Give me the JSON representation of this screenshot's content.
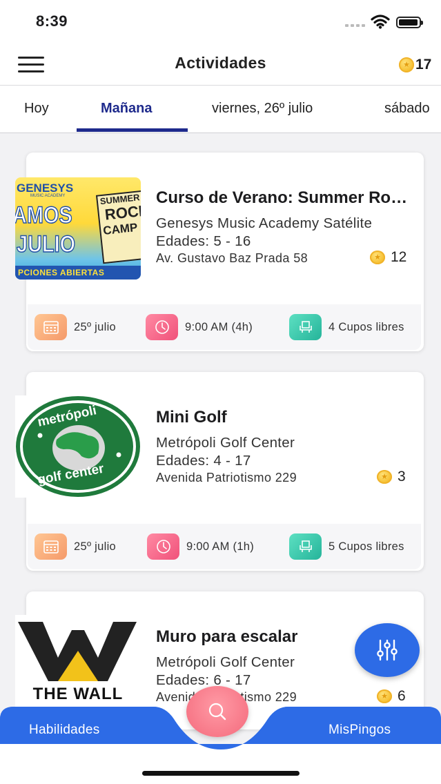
{
  "status_bar": {
    "time": "8:39"
  },
  "header": {
    "title": "Actividades",
    "coins": "17"
  },
  "tabs": [
    {
      "label": "Hoy",
      "active": false
    },
    {
      "label": "Mañana",
      "active": true
    },
    {
      "label": "viernes, 26º julio",
      "active": false
    },
    {
      "label": "sábado",
      "active": false
    }
  ],
  "activities": [
    {
      "title": "Curso de Verano: Summer Rock Camp",
      "venue": "Genesys Music Academy Satélite",
      "ages": "Edades: 5 - 16",
      "address": "Av. Gustavo Baz Prada 58",
      "price": "12",
      "date": "25º julio",
      "time": "9:00 AM (4h)",
      "slots": "4 Cupos libres",
      "thumb": {
        "brand": "GENESYS",
        "brand_sub": "MUSIC ACADEMY",
        "line1": "AMOS",
        "line2": "JULIO",
        "camp1": "SUMMER",
        "camp2": "ROCK",
        "camp3": "CAMP",
        "banner": "PCIONES ABIERTAS"
      }
    },
    {
      "title": "Mini Golf",
      "venue": "Metrópoli Golf Center",
      "ages": "Edades: 4 - 17",
      "address": "Avenida Patriotismo 229",
      "price": "3",
      "date": "25º julio",
      "time": "9:00 AM (1h)",
      "slots": "5 Cupos libres",
      "thumb": {
        "top": "metrópoli",
        "bottom": "golf center"
      }
    },
    {
      "title": "Muro para escalar",
      "venue": "Metrópoli Golf Center",
      "ages": "Edades: 6 - 17",
      "address": "Avenida Patriotismo 229",
      "price": "6",
      "thumb": {
        "brand": "THE WALL"
      }
    }
  ],
  "bottom_nav": {
    "left": "Habilidades",
    "right": "MisPingos"
  },
  "colors": {
    "primary": "#2d6be6",
    "tab_active": "#1e2a8c",
    "search": "#f46a7c",
    "coin": "#f5bc2a"
  },
  "icons": [
    "menu-icon",
    "coin-icon",
    "calendar-icon",
    "clock-icon",
    "seat-icon",
    "filter-icon",
    "search-icon"
  ]
}
